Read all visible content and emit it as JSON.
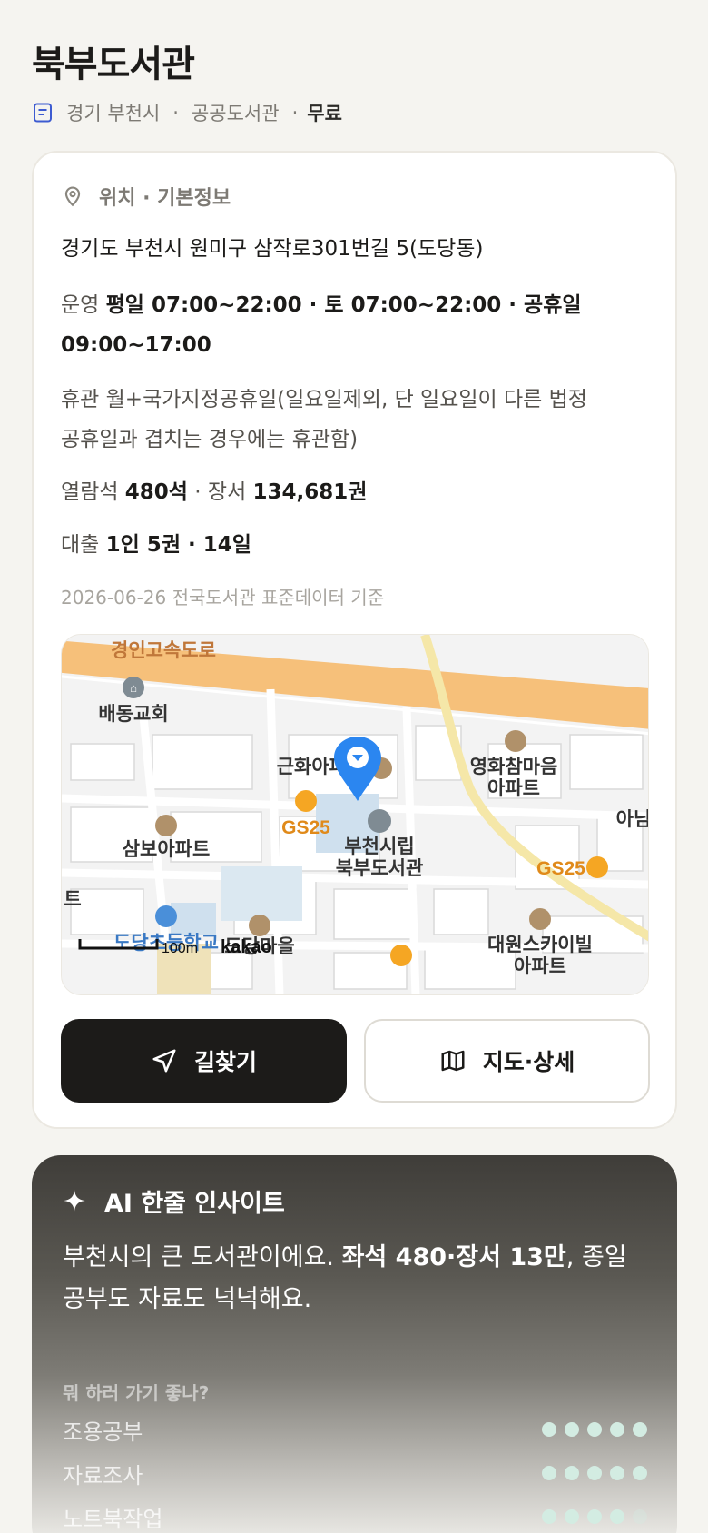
{
  "title": "북부도서관",
  "subtitle": {
    "region": "경기 부천시",
    "type": "공공도서관",
    "price": "무료",
    "sep": "·"
  },
  "info": {
    "section_label": "위치 · 기본정보",
    "address": "경기도 부천시 원미구 삼작로301번길 5(도당동)",
    "hours_label": "운영",
    "hours_value": "평일 07:00~22:00 · 토 07:00~22:00 · 공휴일 09:00~17:00",
    "closed": "휴관 월+국가지정공휴일(일요일제외, 단 일요일이 다른 법정공휴일과 겹치는 경우에는 휴관함)",
    "seats_label": "열람석",
    "seats_value": "480석",
    "books_label": "장서",
    "books_value": "134,681권",
    "loan_label": "대출",
    "loan_value": "1인 5권 · 14일",
    "source": "2026-06-26 전국도서관 표준데이터 기준"
  },
  "map": {
    "labels": {
      "expressway": "경인고속도로",
      "church": "배동교회",
      "apt_geunhwa": "근화아파트",
      "apt_younghwa_1": "영화참마음",
      "apt_younghwa_2": "아파트",
      "gs25_a": "GS25",
      "apt_sambo": "삼보아파트",
      "library_1": "부천시립",
      "library_2": "북부도서관",
      "gs25_b": "GS25",
      "edge_right": "아님",
      "edge_left_1": "트",
      "edge_left_2": "",
      "school": "도당초등학교",
      "apt_dangwang": "도당마을",
      "apt_daewon_1": "대원스카이빌",
      "apt_daewon_2": "아파트",
      "scale": "100m",
      "provider": "kakao"
    }
  },
  "buttons": {
    "directions": "길찾기",
    "map_detail": "지도·상세"
  },
  "ai": {
    "title": "AI 한줄 인사이트",
    "text_a": "부천시의 큰 도서관이에요. ",
    "text_b": "좌석 480·장서 13만",
    "text_c": ", 종일 공부도 자료도 넉넉해요.",
    "question": "뭐 하러 가기 좋나?",
    "ratings": [
      {
        "label": "조용공부",
        "score": 5
      },
      {
        "label": "자료조사",
        "score": 5
      },
      {
        "label": "노트북작업",
        "score": 4
      }
    ]
  },
  "colors": {
    "accent_pin": "#2b86f0",
    "gs25": "#f5a623",
    "apt_icon": "#b0916a",
    "dot": "#d3ece2",
    "primary_button": "#1c1b19"
  }
}
